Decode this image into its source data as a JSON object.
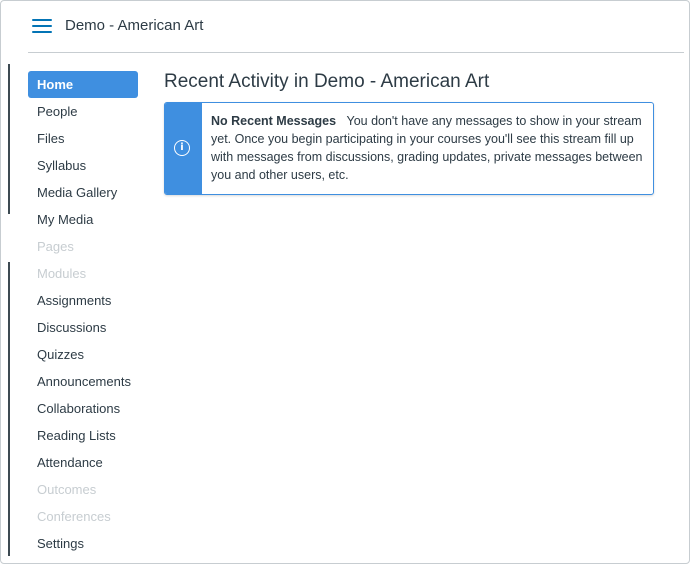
{
  "header": {
    "menu_icon": "hamburger-menu-icon",
    "course_title": "Demo - American Art"
  },
  "nav": {
    "items": [
      {
        "label": "Home",
        "state": "active"
      },
      {
        "label": "People",
        "state": "enabled"
      },
      {
        "label": "Files",
        "state": "enabled"
      },
      {
        "label": "Syllabus",
        "state": "enabled"
      },
      {
        "label": "Media Gallery",
        "state": "enabled"
      },
      {
        "label": "My Media",
        "state": "enabled"
      },
      {
        "label": "Pages",
        "state": "disabled"
      },
      {
        "label": "Modules",
        "state": "disabled"
      },
      {
        "label": "Assignments",
        "state": "enabled"
      },
      {
        "label": "Discussions",
        "state": "enabled"
      },
      {
        "label": "Quizzes",
        "state": "enabled"
      },
      {
        "label": "Announcements",
        "state": "enabled"
      },
      {
        "label": "Collaborations",
        "state": "enabled"
      },
      {
        "label": "Reading Lists",
        "state": "enabled"
      },
      {
        "label": "Attendance",
        "state": "enabled"
      },
      {
        "label": "Outcomes",
        "state": "disabled"
      },
      {
        "label": "Conferences",
        "state": "disabled"
      },
      {
        "label": "Settings",
        "state": "enabled"
      }
    ]
  },
  "main": {
    "heading": "Recent Activity in Demo - American Art",
    "alert": {
      "icon": "info-icon",
      "icon_glyph": "i",
      "title": "No Recent Messages",
      "message": "You don't have any messages to show in your stream yet. Once you begin participating in your courses you'll see this stream fill up with messages from discussions, grading updates, private messages between you and other users, etc."
    }
  },
  "colors": {
    "accent": "#3f8fe0",
    "link": "#0374b5",
    "text": "#2d3b45",
    "disabled_text": "#c7cdd1",
    "border": "#c7cdd1"
  }
}
